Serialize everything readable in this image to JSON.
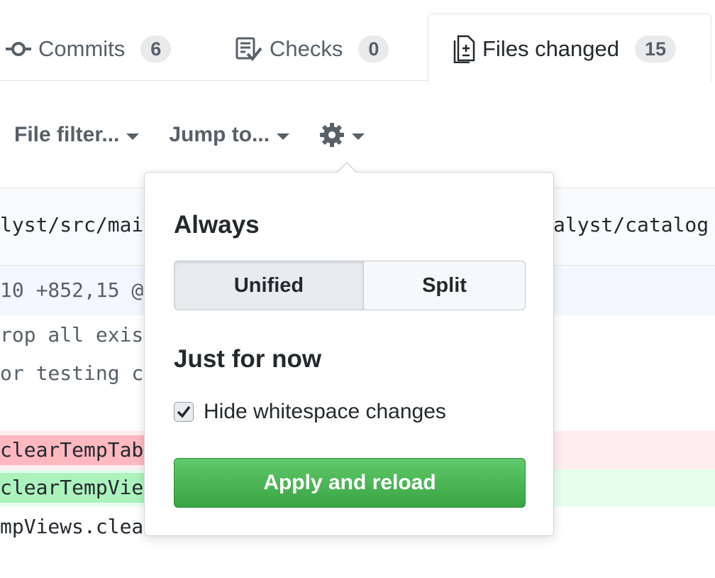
{
  "tabs": {
    "commits": {
      "label": "Commits",
      "count": "6",
      "icon": "git-commit-icon"
    },
    "checks": {
      "label": "Checks",
      "count": "0",
      "icon": "checklist-icon"
    },
    "files": {
      "label": "Files changed",
      "count": "15",
      "icon": "file-diff-icon"
    }
  },
  "toolbar": {
    "file_filter": "File filter...",
    "jump_to": "Jump to...",
    "settings_icon": "gear-icon"
  },
  "diff": {
    "path_left": "lyst/src/mai",
    "path_right": "alyst/catalog",
    "hunk": "10 +852,15 @",
    "context_line_1": "rop all exis",
    "context_line_2": "or testing c",
    "deleted_line": "clearTempTab",
    "added_line": "clearTempVie",
    "context_line_3": "mpViews.clea"
  },
  "popover": {
    "always_heading": "Always",
    "unified_label": "Unified",
    "split_label": "Split",
    "selected_view": "Unified",
    "now_heading": "Just for now",
    "hide_whitespace_label": "Hide whitespace changes",
    "hide_whitespace_checked": true,
    "apply_label": "Apply and reload"
  },
  "colors": {
    "apply_button": "#3aa343",
    "deleted_line_bg": "#ffeef0",
    "added_line_bg": "#e6ffed",
    "hunk_bg": "#f1f8ff"
  }
}
